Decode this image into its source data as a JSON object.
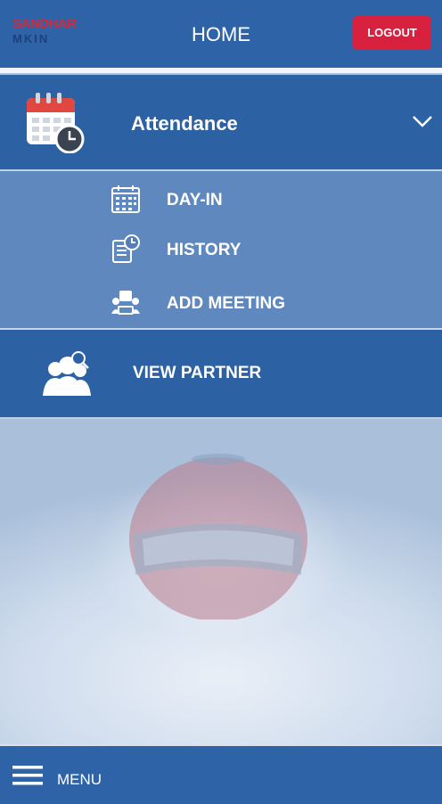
{
  "header": {
    "logo_top": "SANDHAR",
    "logo_bottom": "MKIN",
    "title": "HOME",
    "logout_label": "LOGOUT"
  },
  "attendance": {
    "label": "Attendance",
    "expanded": true
  },
  "submenu": {
    "items": [
      {
        "label": "DAY-IN",
        "icon": "calendar-grid-icon"
      },
      {
        "label": "HISTORY",
        "icon": "history-clock-icon"
      },
      {
        "label": "ADD MEETING",
        "icon": "meeting-icon"
      }
    ]
  },
  "partner": {
    "label": "VIEW PARTNER",
    "icon": "partner-search-icon"
  },
  "bottombar": {
    "menu_label": "MENU",
    "icon": "hamburger-menu-icon"
  },
  "colors": {
    "primary": "#2e64a7",
    "logout": "#d8213f",
    "submenu": "#527ebA"
  }
}
